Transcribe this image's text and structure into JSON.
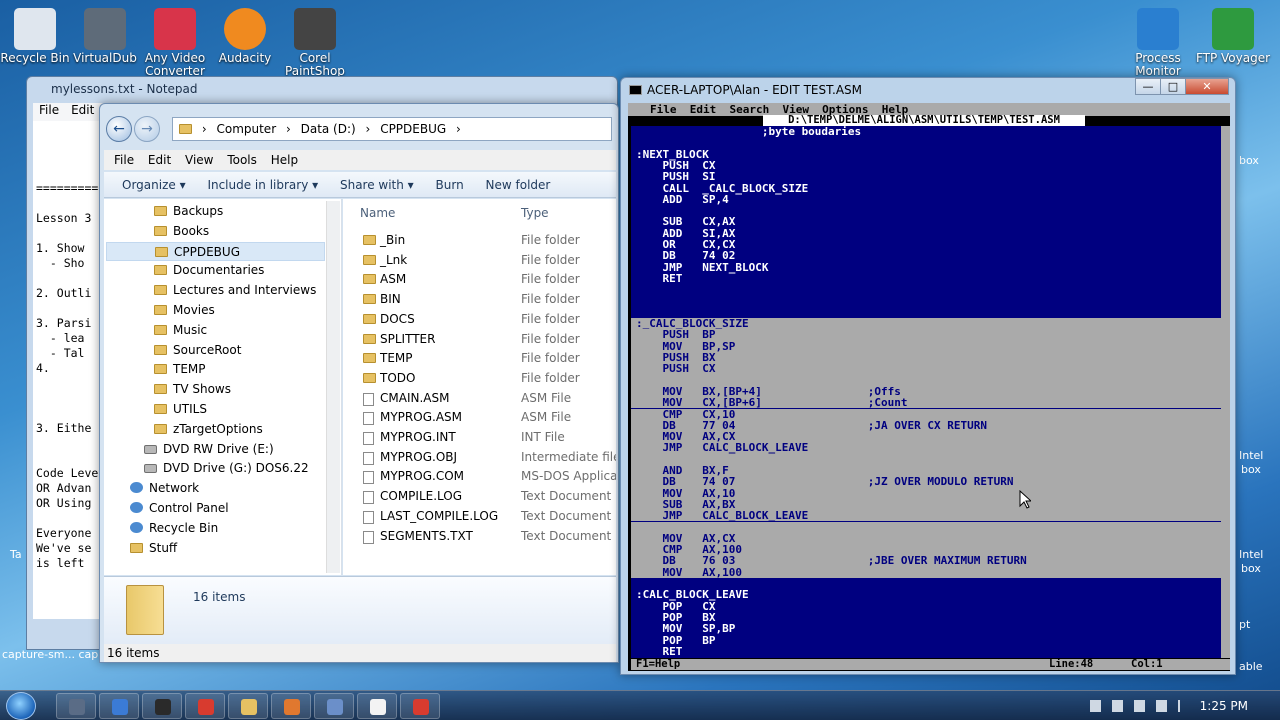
{
  "desktop": {
    "icons": [
      {
        "label": "Recycle Bin",
        "color": "#dfe6ee"
      },
      {
        "label": "VirtualDub",
        "color": "#5e6b79"
      },
      {
        "label": "Any Video Converter",
        "color": "#d8344a"
      },
      {
        "label": "Audacity",
        "color": "#f08a1f"
      },
      {
        "label": "Corel PaintShop",
        "color": "#444"
      },
      {
        "label": "Process Monitor",
        "color": "#2a7fd0"
      },
      {
        "label": "FTP Voyager",
        "color": "#2e9a3f"
      }
    ],
    "right_fragments": [
      "box",
      "Intel",
      "box",
      "Intel",
      "box",
      "pt",
      "able"
    ],
    "left_fragments": [
      "Ta",
      "capture-sm... capture"
    ]
  },
  "notepad": {
    "title": "mylessons.txt - Notepad",
    "menu": [
      "File",
      "Edit"
    ],
    "lines": [
      "",
      "",
      "",
      "",
      "=========",
      "",
      "Lesson 3",
      "",
      "1. Show",
      "  - Sho",
      "",
      "2. Outli",
      "",
      "3. Parsi",
      "  - lea",
      "  - Tal",
      "4.",
      "",
      "",
      "",
      "3. Eithe",
      "",
      "",
      "Code Leve",
      "OR Advan",
      "OR Using",
      "",
      "Everyone",
      "We've se",
      "is left"
    ]
  },
  "explorer": {
    "address": [
      "Computer",
      "Data (D:)",
      "CPPDEBUG"
    ],
    "menu": [
      "File",
      "Edit",
      "View",
      "Tools",
      "Help"
    ],
    "toolbar": [
      "Organize ▾",
      "Include in library ▾",
      "Share with ▾",
      "Burn",
      "New folder"
    ],
    "nav": [
      {
        "label": "Backups",
        "icon": "folder"
      },
      {
        "label": "Books",
        "icon": "folder"
      },
      {
        "label": "CPPDEBUG",
        "icon": "folder",
        "selected": true
      },
      {
        "label": "Documentaries",
        "icon": "folder"
      },
      {
        "label": "Lectures and Interviews",
        "icon": "folder"
      },
      {
        "label": "Movies",
        "icon": "folder"
      },
      {
        "label": "Music",
        "icon": "folder"
      },
      {
        "label": "SourceRoot",
        "icon": "folder"
      },
      {
        "label": "TEMP",
        "icon": "folder"
      },
      {
        "label": "TV Shows",
        "icon": "folder"
      },
      {
        "label": "UTILS",
        "icon": "folder"
      },
      {
        "label": "zTargetOptions",
        "icon": "folder"
      },
      {
        "label": "DVD RW Drive (E:)",
        "icon": "drive",
        "top": true
      },
      {
        "label": "DVD Drive (G:) DOS6.22",
        "icon": "drive",
        "top": true
      },
      {
        "label": "Network",
        "icon": "net",
        "root": true
      },
      {
        "label": "Control Panel",
        "icon": "net",
        "root": true
      },
      {
        "label": "Recycle Bin",
        "icon": "net",
        "root": true
      },
      {
        "label": "Stuff",
        "icon": "folder",
        "root": true
      }
    ],
    "columns": {
      "name": "Name",
      "type": "Type"
    },
    "files": [
      {
        "name": "_Bin",
        "type": "File folder",
        "icon": "folder"
      },
      {
        "name": "_Lnk",
        "type": "File folder",
        "icon": "folder"
      },
      {
        "name": "ASM",
        "type": "File folder",
        "icon": "folder"
      },
      {
        "name": "BIN",
        "type": "File folder",
        "icon": "folder"
      },
      {
        "name": "DOCS",
        "type": "File folder",
        "icon": "folder"
      },
      {
        "name": "SPLITTER",
        "type": "File folder",
        "icon": "folder"
      },
      {
        "name": "TEMP",
        "type": "File folder",
        "icon": "folder"
      },
      {
        "name": "TODO",
        "type": "File folder",
        "icon": "folder"
      },
      {
        "name": "CMAIN.ASM",
        "type": "ASM File",
        "icon": "file"
      },
      {
        "name": "MYPROG.ASM",
        "type": "ASM File",
        "icon": "file"
      },
      {
        "name": "MYPROG.INT",
        "type": "INT File",
        "icon": "file"
      },
      {
        "name": "MYPROG.OBJ",
        "type": "Intermediate file",
        "icon": "file"
      },
      {
        "name": "MYPROG.COM",
        "type": "MS-DOS Applicatio",
        "icon": "file"
      },
      {
        "name": "COMPILE.LOG",
        "type": "Text Document",
        "icon": "file"
      },
      {
        "name": "LAST_COMPILE.LOG",
        "type": "Text Document",
        "icon": "file"
      },
      {
        "name": "SEGMENTS.TXT",
        "type": "Text Document",
        "icon": "file"
      }
    ],
    "details_count": "16 items",
    "status": "16 items"
  },
  "dosedit": {
    "title": "ACER-LAPTOP\\Alan - EDIT  TEST.ASM",
    "menu": "File  Edit  Search  View  Options  Help",
    "path": "D:\\TEMP\\DELME\\ALIGN\\ASM\\UTILS\\TEMP\\TEST.ASM",
    "lines": [
      {
        "t": "                   ;byte boudaries"
      },
      {
        "t": ""
      },
      {
        "t": ":NEXT_BLOCK"
      },
      {
        "t": "    PUSH  CX"
      },
      {
        "t": "    PUSH  SI"
      },
      {
        "t": "    CALL  _CALC_BLOCK_SIZE"
      },
      {
        "t": "    ADD   SP,4"
      },
      {
        "t": ""
      },
      {
        "t": "    SUB   CX,AX"
      },
      {
        "t": "    ADD   SI,AX"
      },
      {
        "t": "    OR    CX,CX"
      },
      {
        "t": "    DB    74 02"
      },
      {
        "t": "    JMP   NEXT_BLOCK"
      },
      {
        "t": "    RET"
      },
      {
        "t": ""
      },
      {
        "t": ""
      },
      {
        "t": ""
      },
      {
        "t": ":_CALC_BLOCK_SIZE",
        "sel": true
      },
      {
        "t": "    PUSH  BP",
        "sel": true
      },
      {
        "t": "    MOV   BP,SP",
        "sel": true
      },
      {
        "t": "    PUSH  BX",
        "sel": true
      },
      {
        "t": "    PUSH  CX",
        "sel": true
      },
      {
        "t": "",
        "sel": true
      },
      {
        "t": "    MOV   BX,[BP+4]                ;Offs",
        "sel": true
      },
      {
        "t": "    MOV   CX,[BP+6]                ;Count",
        "sel": true
      },
      {
        "t": "    CMP   CX,10",
        "sel": true
      },
      {
        "t": "    DB    77 04                    ;JA OVER CX RETURN",
        "sel": true
      },
      {
        "t": "    MOV   AX,CX",
        "sel": true
      },
      {
        "t": "    JMP   CALC_BLOCK_LEAVE",
        "sel": true
      },
      {
        "t": "",
        "sel": true
      },
      {
        "t": "    AND   BX,F",
        "sel": true
      },
      {
        "t": "    DB    74 07                    ;JZ OVER MODULO RETURN",
        "sel": true
      },
      {
        "t": "    MOV   AX,10",
        "sel": true
      },
      {
        "t": "    SUB   AX,BX",
        "sel": true
      },
      {
        "t": "    JMP   CALC_BLOCK_LEAVE",
        "sel": true
      },
      {
        "t": "",
        "sel": true
      },
      {
        "t": "    MOV   AX,CX",
        "sel": true
      },
      {
        "t": "    CMP   AX,100",
        "sel": true
      },
      {
        "t": "    DB    76 03                    ;JBE OVER MAXIMUM RETURN",
        "sel": true
      },
      {
        "t": "    MOV   AX,100",
        "sel": true
      },
      {
        "t": ""
      },
      {
        "t": ":CALC_BLOCK_LEAVE"
      },
      {
        "t": "    POP   CX"
      },
      {
        "t": "    POP   BX"
      },
      {
        "t": "    MOV   SP,BP"
      },
      {
        "t": "    POP   BP"
      },
      {
        "t": "    RET"
      }
    ],
    "status_help": "F1=Help",
    "status_line": "Line:48",
    "status_col": "Col:1"
  },
  "taskbar": {
    "clock": "1:25 PM",
    "buttons": [
      "#5a6c86",
      "#3b7bd6",
      "#2a2a2a",
      "#d83b2f",
      "#e6c163",
      "#e0782f",
      "#6b8fc9",
      "#f3f3f3",
      "#d83b2f"
    ]
  }
}
